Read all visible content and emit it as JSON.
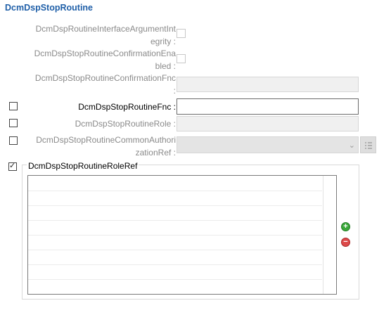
{
  "section_title": "DcmDspStopRoutine",
  "fields": {
    "interface_argument_integrity": {
      "label_line1": "DcmDspRoutineInterfaceArgumentInt",
      "label_line2": "egrity :"
    },
    "confirmation_enabled": {
      "label_line1": "DcmDspStopRoutineConfirmationEna",
      "label_line2": "bled :"
    },
    "confirmation_fnc": {
      "label_line1": "DcmDspStopRoutineConfirmationFnc",
      "label_line2": ":",
      "value": ""
    },
    "stop_routine_fnc": {
      "label": "DcmDspStopRoutineFnc :",
      "value": "",
      "enabled": false
    },
    "stop_routine_role": {
      "label": "DcmDspStopRoutineRole :",
      "value": "",
      "enabled": false
    },
    "common_authorization_ref": {
      "label_line1": "DcmDspStopRoutineCommonAuthori",
      "label_line2": "zationRef :",
      "value": "",
      "enabled": false
    }
  },
  "role_ref_group": {
    "label": "DcmDspStopRoutineRoleRef",
    "checkbox_glyph": "✓",
    "enabled": true,
    "rows": [
      "",
      "",
      "",
      "",
      "",
      "",
      ""
    ],
    "add_icon": "plus-circle-icon",
    "remove_icon": "minus-circle-icon"
  },
  "icons": {
    "dropdown": "chevron-down-icon",
    "browse": "list-icon",
    "add_glyph": "+",
    "remove_glyph": "−",
    "dropdown_glyph": "⌄"
  },
  "colors": {
    "title": "#1f5fa8",
    "add": "#3aa83a",
    "remove": "#dd4a4a"
  }
}
